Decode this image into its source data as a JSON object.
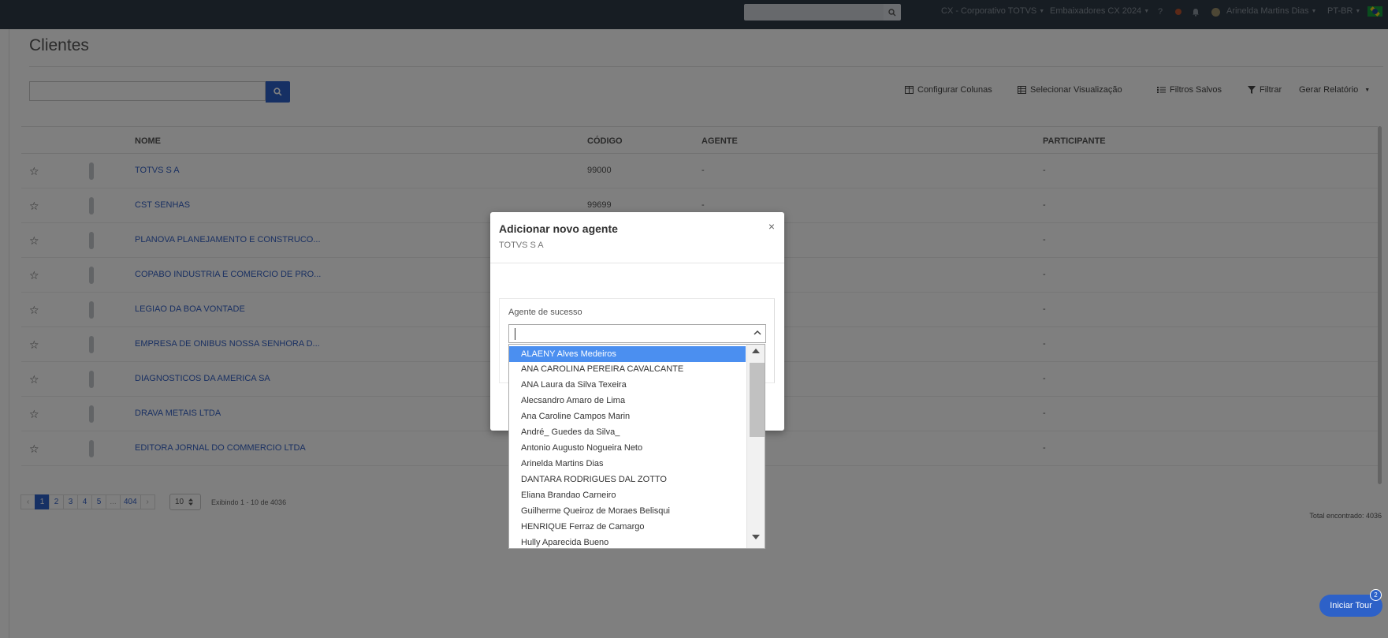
{
  "navbar": {
    "search_placeholder": "",
    "company": "CX - Corporativo TOTVS",
    "program": "Embaixadores CX 2024",
    "user": "Arinelda Martins Dias",
    "locale": "PT-BR"
  },
  "page": {
    "title": "Clientes",
    "search_placeholder": ""
  },
  "toolbar": {
    "configure_columns": "Configurar Colunas",
    "select_view": "Selecionar Visualização",
    "saved_filters": "Filtros Salvos",
    "filter": "Filtrar",
    "report": "Gerar Relatório"
  },
  "table": {
    "headers": {
      "name": "NOME",
      "code": "CÓDIGO",
      "agent": "AGENTE",
      "participant": "PARTICIPANTE"
    },
    "rows": [
      {
        "name": "TOTVS S A",
        "code": "99000",
        "agent": "-",
        "participant": "-"
      },
      {
        "name": "CST SENHAS",
        "code": "99699",
        "agent": "-",
        "participant": "-"
      },
      {
        "name": "PLANOVA PLANEJAMENTO E CONSTRUCO...",
        "code": "",
        "agent": "",
        "participant": "-"
      },
      {
        "name": "COPABO INDUSTRIA E COMERCIO DE PRO...",
        "code": "",
        "agent": "",
        "participant": "-"
      },
      {
        "name": "LEGIAO DA BOA VONTADE",
        "code": "",
        "agent": "",
        "participant": "-"
      },
      {
        "name": "EMPRESA DE ONIBUS NOSSA SENHORA D...",
        "code": "",
        "agent": "",
        "participant": "-"
      },
      {
        "name": "DIAGNOSTICOS DA AMERICA SA",
        "code": "",
        "agent": "",
        "participant": "-"
      },
      {
        "name": "DRAVA METAIS LTDA",
        "code": "",
        "agent": "",
        "participant": "-"
      },
      {
        "name": "EDITORA JORNAL DO COMMERCIO LTDA",
        "code": "",
        "agent": "",
        "participant": "-"
      }
    ]
  },
  "pagination": {
    "prev": "‹",
    "pages": [
      "1",
      "2",
      "3",
      "4",
      "5",
      "...",
      "404"
    ],
    "next": "›",
    "per_page": "10",
    "showing": "Exibindo 1 - 10 de 4036",
    "total": "Total encontrado: 4036"
  },
  "modal": {
    "title": "Adicionar novo agente",
    "subtitle": "TOTVS S A",
    "close": "×",
    "field_label": "Agente de sucesso",
    "options": [
      "ALAENY Alves Medeiros",
      "ANA CAROLINA PEREIRA CAVALCANTE",
      "ANA Laura da Silva Texeira",
      "Alecsandro Amaro de Lima",
      "Ana Caroline Campos Marin",
      "André_ Guedes da Silva_",
      "Antonio Augusto Nogueira Neto",
      "Arinelda Martins Dias",
      "DANTARA RODRIGUES DAL ZOTTO",
      "Eliana Brandao Carneiro",
      "Guilherme Queiroz de Moraes Belisqui",
      "HENRIQUE Ferraz de Camargo",
      "Hully Aparecida Bueno"
    ],
    "selected_index": 0
  },
  "tour": {
    "label": "Iniciar Tour",
    "badge": "2"
  },
  "colors": {
    "navbar": "#2f3a46",
    "primary": "#2d61c8",
    "selected_option": "#4b8ff0",
    "link": "#3461c4"
  }
}
